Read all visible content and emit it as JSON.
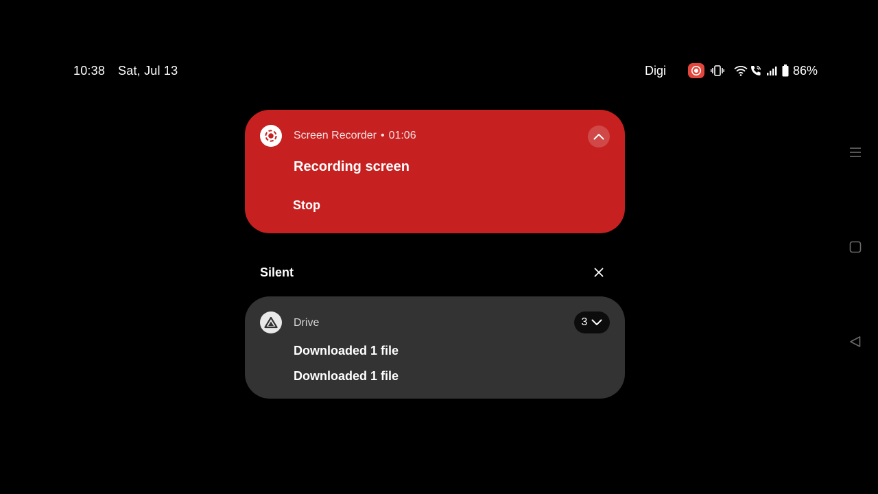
{
  "status_bar": {
    "time": "10:38",
    "date": "Sat, Jul 13",
    "carrier": "Digi",
    "battery_percent": "86%",
    "icons": [
      "screen-recording-icon",
      "vibrate-icon",
      "wifi-icon",
      "wifi-calling-icon",
      "signal-icon",
      "battery-icon"
    ]
  },
  "recorder_notification": {
    "app_name": "Screen Recorder",
    "separator": "•",
    "elapsed": "01:06",
    "title": "Recording screen",
    "action_label": "Stop",
    "icon": "screen-recorder-icon",
    "collapse_icon": "chevron-up-icon",
    "background_color": "#c62120"
  },
  "silent_section": {
    "label": "Silent",
    "clear_icon": "close-icon"
  },
  "drive_notification": {
    "app_name": "Drive",
    "count": "3",
    "lines": [
      "Downloaded 1 file",
      "Downloaded 1 file"
    ],
    "icon": "drive-icon",
    "expand_icon": "chevron-down-icon",
    "background_color": "#333333"
  },
  "nav_bar": {
    "buttons": [
      "recents-icon",
      "home-icon",
      "back-icon"
    ]
  }
}
